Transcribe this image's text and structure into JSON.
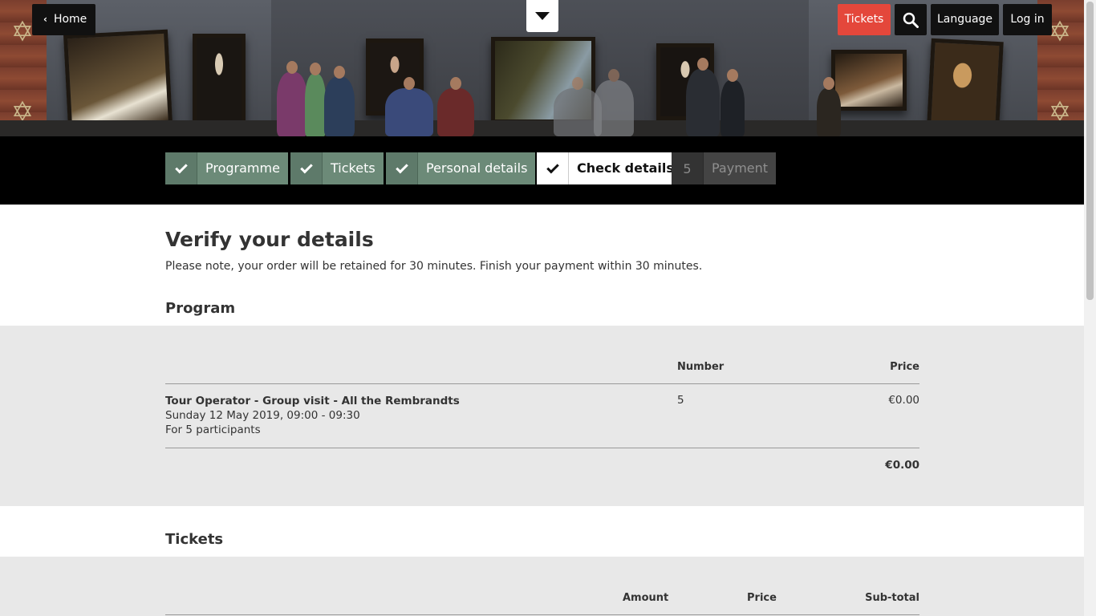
{
  "header": {
    "home_label": "Home",
    "tickets_label": "Tickets",
    "language_label": "Language",
    "login_label": "Log in",
    "accent_color": "#e4473b"
  },
  "steps": [
    {
      "label": "Programme",
      "state": "done",
      "badge": "check-icon"
    },
    {
      "label": "Tickets",
      "state": "done",
      "badge": "check-icon"
    },
    {
      "label": "Personal details",
      "state": "done",
      "badge": "check-icon"
    },
    {
      "label": "Check details",
      "state": "current",
      "badge": "check-icon"
    },
    {
      "label": "Payment",
      "state": "todo",
      "badge": "5"
    }
  ],
  "main": {
    "title": "Verify your details",
    "note": "Please note, your order will be retained for 30 minutes. Finish your payment within 30 minutes."
  },
  "program": {
    "heading": "Program",
    "col_number": "Number",
    "col_price": "Price",
    "item_title": "Tour Operator - Group visit - All the Rembrandts",
    "item_date": "Sunday 12 May 2019, 09:00 - 09:30",
    "item_participants": "For 5 participants",
    "item_number": "5",
    "item_price": "€0.00",
    "total": "€0.00"
  },
  "tickets": {
    "heading": "Tickets",
    "col_amount": "Amount",
    "col_price": "Price",
    "col_subtotal": "Sub-total"
  }
}
